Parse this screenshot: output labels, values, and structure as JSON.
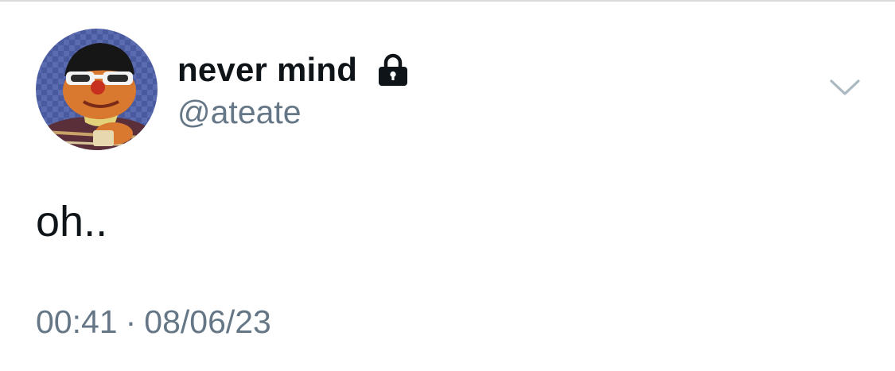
{
  "tweet": {
    "display_name": "never mind",
    "handle": "@ateate",
    "text": "oh..",
    "time": "00:41",
    "separator": "·",
    "date": "08/06/23",
    "protected_icon": "lock-icon",
    "menu_icon": "chevron-down-icon",
    "avatar_description": "avatar"
  },
  "colors": {
    "text_primary": "#0f1419",
    "text_secondary": "#657786",
    "divider": "#d9d9d9",
    "chevron": "#aab8c2"
  }
}
